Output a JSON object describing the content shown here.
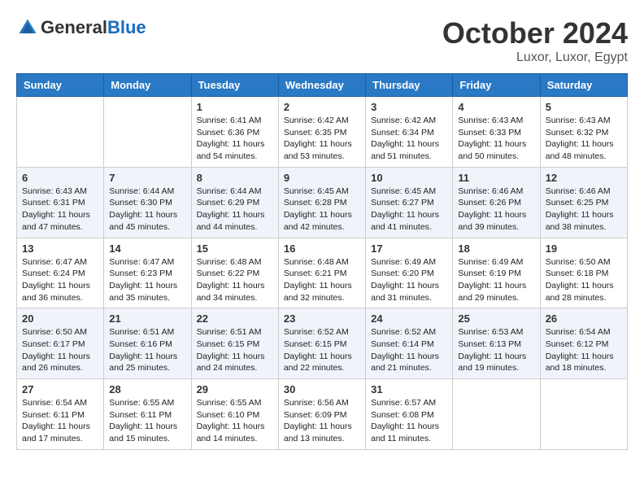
{
  "header": {
    "logo_general": "General",
    "logo_blue": "Blue",
    "month_title": "October 2024",
    "location": "Luxor, Luxor, Egypt"
  },
  "weekdays": [
    "Sunday",
    "Monday",
    "Tuesday",
    "Wednesday",
    "Thursday",
    "Friday",
    "Saturday"
  ],
  "weeks": [
    [
      {
        "day": "",
        "sunrise": "",
        "sunset": "",
        "daylight": ""
      },
      {
        "day": "",
        "sunrise": "",
        "sunset": "",
        "daylight": ""
      },
      {
        "day": "1",
        "sunrise": "Sunrise: 6:41 AM",
        "sunset": "Sunset: 6:36 PM",
        "daylight": "Daylight: 11 hours and 54 minutes."
      },
      {
        "day": "2",
        "sunrise": "Sunrise: 6:42 AM",
        "sunset": "Sunset: 6:35 PM",
        "daylight": "Daylight: 11 hours and 53 minutes."
      },
      {
        "day": "3",
        "sunrise": "Sunrise: 6:42 AM",
        "sunset": "Sunset: 6:34 PM",
        "daylight": "Daylight: 11 hours and 51 minutes."
      },
      {
        "day": "4",
        "sunrise": "Sunrise: 6:43 AM",
        "sunset": "Sunset: 6:33 PM",
        "daylight": "Daylight: 11 hours and 50 minutes."
      },
      {
        "day": "5",
        "sunrise": "Sunrise: 6:43 AM",
        "sunset": "Sunset: 6:32 PM",
        "daylight": "Daylight: 11 hours and 48 minutes."
      }
    ],
    [
      {
        "day": "6",
        "sunrise": "Sunrise: 6:43 AM",
        "sunset": "Sunset: 6:31 PM",
        "daylight": "Daylight: 11 hours and 47 minutes."
      },
      {
        "day": "7",
        "sunrise": "Sunrise: 6:44 AM",
        "sunset": "Sunset: 6:30 PM",
        "daylight": "Daylight: 11 hours and 45 minutes."
      },
      {
        "day": "8",
        "sunrise": "Sunrise: 6:44 AM",
        "sunset": "Sunset: 6:29 PM",
        "daylight": "Daylight: 11 hours and 44 minutes."
      },
      {
        "day": "9",
        "sunrise": "Sunrise: 6:45 AM",
        "sunset": "Sunset: 6:28 PM",
        "daylight": "Daylight: 11 hours and 42 minutes."
      },
      {
        "day": "10",
        "sunrise": "Sunrise: 6:45 AM",
        "sunset": "Sunset: 6:27 PM",
        "daylight": "Daylight: 11 hours and 41 minutes."
      },
      {
        "day": "11",
        "sunrise": "Sunrise: 6:46 AM",
        "sunset": "Sunset: 6:26 PM",
        "daylight": "Daylight: 11 hours and 39 minutes."
      },
      {
        "day": "12",
        "sunrise": "Sunrise: 6:46 AM",
        "sunset": "Sunset: 6:25 PM",
        "daylight": "Daylight: 11 hours and 38 minutes."
      }
    ],
    [
      {
        "day": "13",
        "sunrise": "Sunrise: 6:47 AM",
        "sunset": "Sunset: 6:24 PM",
        "daylight": "Daylight: 11 hours and 36 minutes."
      },
      {
        "day": "14",
        "sunrise": "Sunrise: 6:47 AM",
        "sunset": "Sunset: 6:23 PM",
        "daylight": "Daylight: 11 hours and 35 minutes."
      },
      {
        "day": "15",
        "sunrise": "Sunrise: 6:48 AM",
        "sunset": "Sunset: 6:22 PM",
        "daylight": "Daylight: 11 hours and 34 minutes."
      },
      {
        "day": "16",
        "sunrise": "Sunrise: 6:48 AM",
        "sunset": "Sunset: 6:21 PM",
        "daylight": "Daylight: 11 hours and 32 minutes."
      },
      {
        "day": "17",
        "sunrise": "Sunrise: 6:49 AM",
        "sunset": "Sunset: 6:20 PM",
        "daylight": "Daylight: 11 hours and 31 minutes."
      },
      {
        "day": "18",
        "sunrise": "Sunrise: 6:49 AM",
        "sunset": "Sunset: 6:19 PM",
        "daylight": "Daylight: 11 hours and 29 minutes."
      },
      {
        "day": "19",
        "sunrise": "Sunrise: 6:50 AM",
        "sunset": "Sunset: 6:18 PM",
        "daylight": "Daylight: 11 hours and 28 minutes."
      }
    ],
    [
      {
        "day": "20",
        "sunrise": "Sunrise: 6:50 AM",
        "sunset": "Sunset: 6:17 PM",
        "daylight": "Daylight: 11 hours and 26 minutes."
      },
      {
        "day": "21",
        "sunrise": "Sunrise: 6:51 AM",
        "sunset": "Sunset: 6:16 PM",
        "daylight": "Daylight: 11 hours and 25 minutes."
      },
      {
        "day": "22",
        "sunrise": "Sunrise: 6:51 AM",
        "sunset": "Sunset: 6:15 PM",
        "daylight": "Daylight: 11 hours and 24 minutes."
      },
      {
        "day": "23",
        "sunrise": "Sunrise: 6:52 AM",
        "sunset": "Sunset: 6:15 PM",
        "daylight": "Daylight: 11 hours and 22 minutes."
      },
      {
        "day": "24",
        "sunrise": "Sunrise: 6:52 AM",
        "sunset": "Sunset: 6:14 PM",
        "daylight": "Daylight: 11 hours and 21 minutes."
      },
      {
        "day": "25",
        "sunrise": "Sunrise: 6:53 AM",
        "sunset": "Sunset: 6:13 PM",
        "daylight": "Daylight: 11 hours and 19 minutes."
      },
      {
        "day": "26",
        "sunrise": "Sunrise: 6:54 AM",
        "sunset": "Sunset: 6:12 PM",
        "daylight": "Daylight: 11 hours and 18 minutes."
      }
    ],
    [
      {
        "day": "27",
        "sunrise": "Sunrise: 6:54 AM",
        "sunset": "Sunset: 6:11 PM",
        "daylight": "Daylight: 11 hours and 17 minutes."
      },
      {
        "day": "28",
        "sunrise": "Sunrise: 6:55 AM",
        "sunset": "Sunset: 6:11 PM",
        "daylight": "Daylight: 11 hours and 15 minutes."
      },
      {
        "day": "29",
        "sunrise": "Sunrise: 6:55 AM",
        "sunset": "Sunset: 6:10 PM",
        "daylight": "Daylight: 11 hours and 14 minutes."
      },
      {
        "day": "30",
        "sunrise": "Sunrise: 6:56 AM",
        "sunset": "Sunset: 6:09 PM",
        "daylight": "Daylight: 11 hours and 13 minutes."
      },
      {
        "day": "31",
        "sunrise": "Sunrise: 6:57 AM",
        "sunset": "Sunset: 6:08 PM",
        "daylight": "Daylight: 11 hours and 11 minutes."
      },
      {
        "day": "",
        "sunrise": "",
        "sunset": "",
        "daylight": ""
      },
      {
        "day": "",
        "sunrise": "",
        "sunset": "",
        "daylight": ""
      }
    ]
  ]
}
